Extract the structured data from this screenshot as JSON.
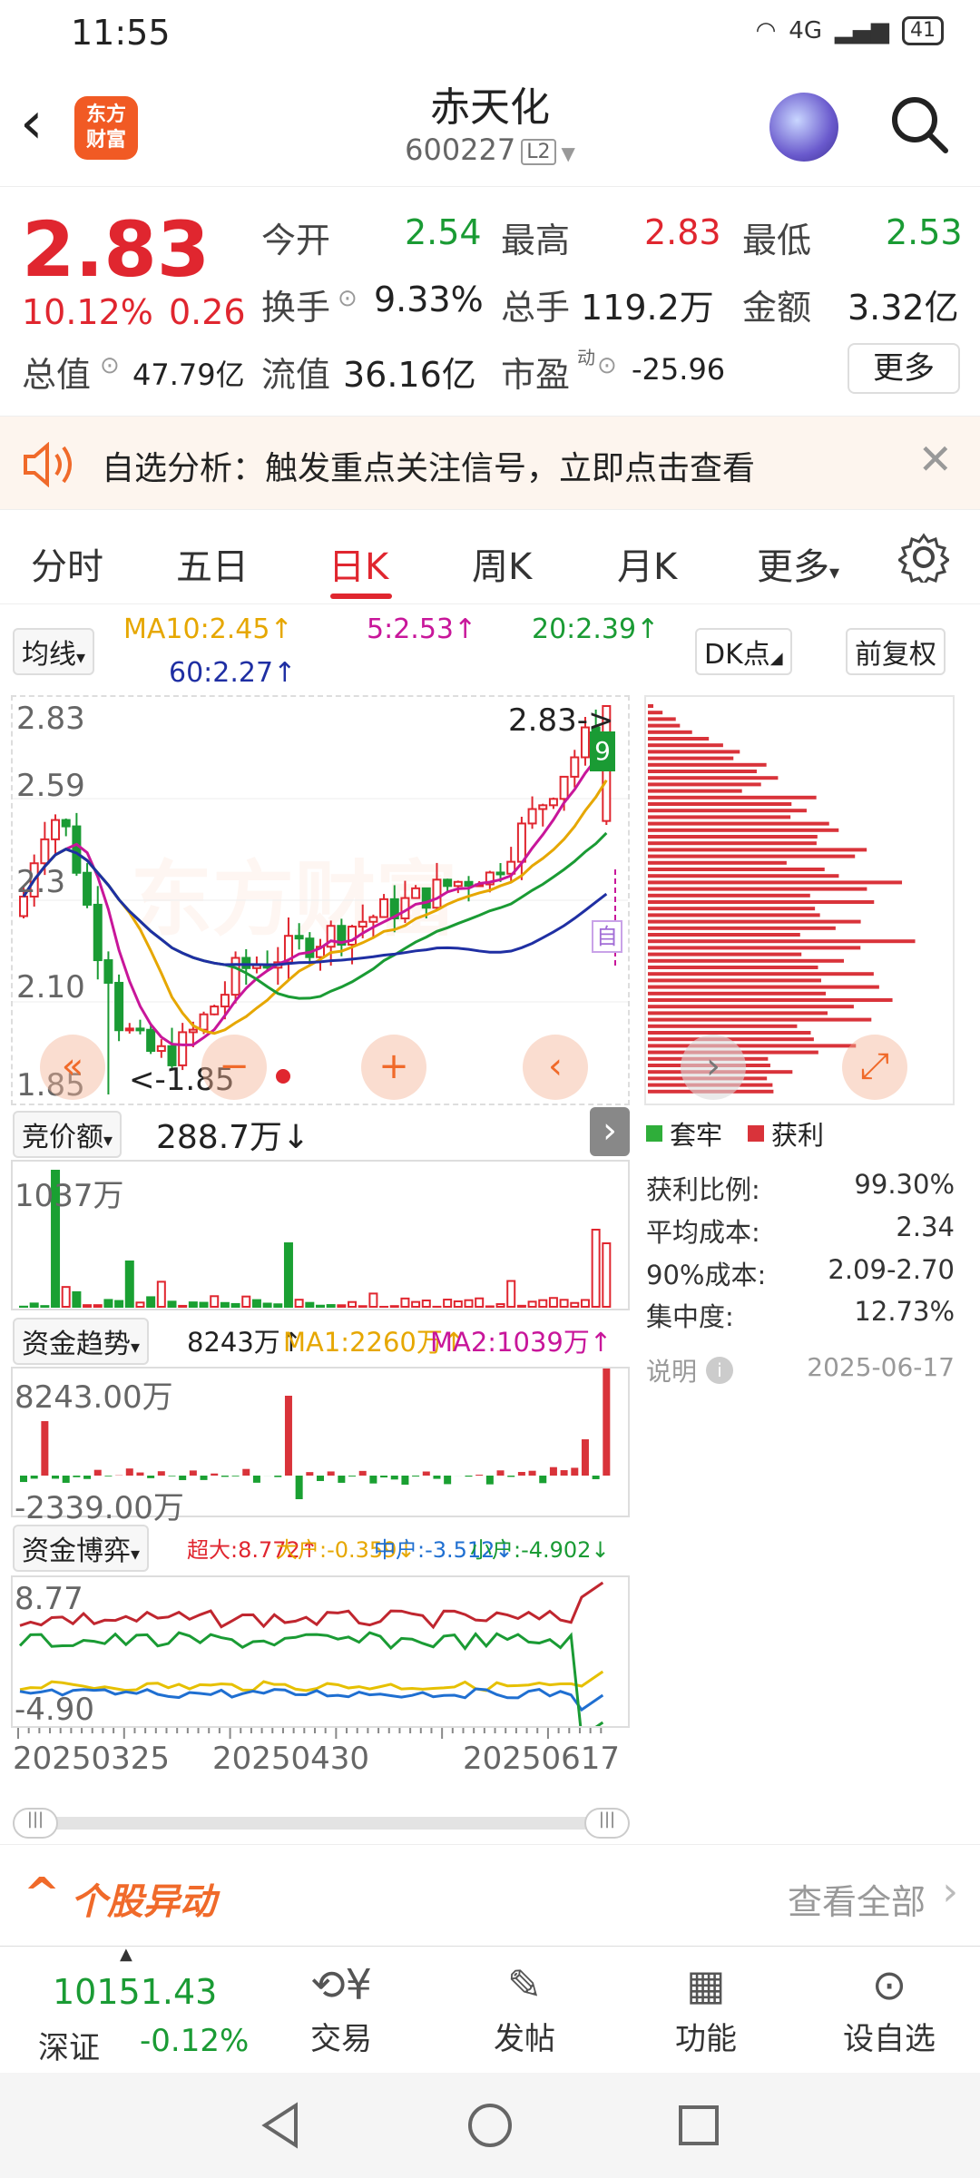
{
  "status": {
    "time": "11:55",
    "battery": "41",
    "network": "4G"
  },
  "header": {
    "logo": "东方\n财富",
    "name": "赤天化",
    "code": "600227",
    "level": "L2"
  },
  "quote": {
    "price": "2.83",
    "pct": "10.12%",
    "chg": "0.26",
    "open_label": "今开",
    "open": "2.54",
    "high_label": "最高",
    "high": "2.83",
    "low_label": "最低",
    "low": "2.53",
    "turnover_label": "换手",
    "turnover": "9.33%",
    "volume_label": "总手",
    "volume": "119.2万",
    "amount_label": "金额",
    "amount": "3.32亿",
    "mktcap_label": "总值",
    "mktcap": "47.79亿",
    "float_label": "流值",
    "float": "36.16亿",
    "pe_label": "市盈",
    "pe_sup": "动",
    "pe": "-25.96",
    "more": "更多"
  },
  "banner": {
    "text": "自选分析：触发重点关注信号，立即点击查看"
  },
  "tabs": [
    "分时",
    "五日",
    "日K",
    "周K",
    "月K",
    "更多"
  ],
  "ma": {
    "type": "均线",
    "ma10": "MA10:2.45↑",
    "ma5": "5:2.53↑",
    "ma20": "20:2.39↑",
    "ma60": "60:2.27↑",
    "dk": "DK点",
    "adjust": "前复权"
  },
  "kline": {
    "y_high": "2.83",
    "y_2": "2.59",
    "y_3": "2.3",
    "y_4": "2.10",
    "y_low": "1.85",
    "high_mark": "2.83->",
    "low_mark": "<-1.85",
    "mark_9": "9"
  },
  "auction": {
    "label": "竞价额",
    "value": "288.7万↓",
    "ymax": "1037万"
  },
  "fund_trend": {
    "label": "资金趋势",
    "value": "8243万↑",
    "ma1": "MA1:2260万↑",
    "ma2": "MA2:1039万↑",
    "ymax": "8243.00万",
    "ymin": "-2339.00万"
  },
  "fund_game": {
    "label": "资金博弈",
    "super": "超大:8.772↑",
    "big": "大户:-0.359↓",
    "mid": "中户:-3.512↓",
    "small": "小户:-4.902↓",
    "ymax": "8.77",
    "ymin": "-4.90"
  },
  "dates": [
    "20250325",
    "20250430",
    "20250617"
  ],
  "chips": {
    "legend_trap": "套牢",
    "legend_profit": "获利",
    "profit_ratio_label": "获利比例:",
    "profit_ratio": "99.30%",
    "avg_cost_label": "平均成本:",
    "avg_cost": "2.34",
    "cost90_label": "90%成本:",
    "cost90": "2.09-2.70",
    "concentration_label": "集中度:",
    "concentration": "12.73%",
    "note_label": "说明",
    "date": "2025-06-17"
  },
  "section": {
    "title": "个股异动",
    "more": "查看全部"
  },
  "index": {
    "value": "10151.43",
    "name": "深证",
    "pct": "-0.12%"
  },
  "nav": [
    "交易",
    "发帖",
    "功能",
    "设自选"
  ],
  "colors": {
    "up": "#e0262f",
    "down": "#1a9b34",
    "accent": "#f06a2a"
  },
  "chart_data": {
    "type": "candlestick",
    "ylim": [
      1.85,
      2.83
    ],
    "last": {
      "open": 2.54,
      "high": 2.83,
      "low": 2.53,
      "close": 2.83
    },
    "ma": {
      "ma5": 2.53,
      "ma10": 2.45,
      "ma20": 2.39,
      "ma60": 2.27
    }
  }
}
